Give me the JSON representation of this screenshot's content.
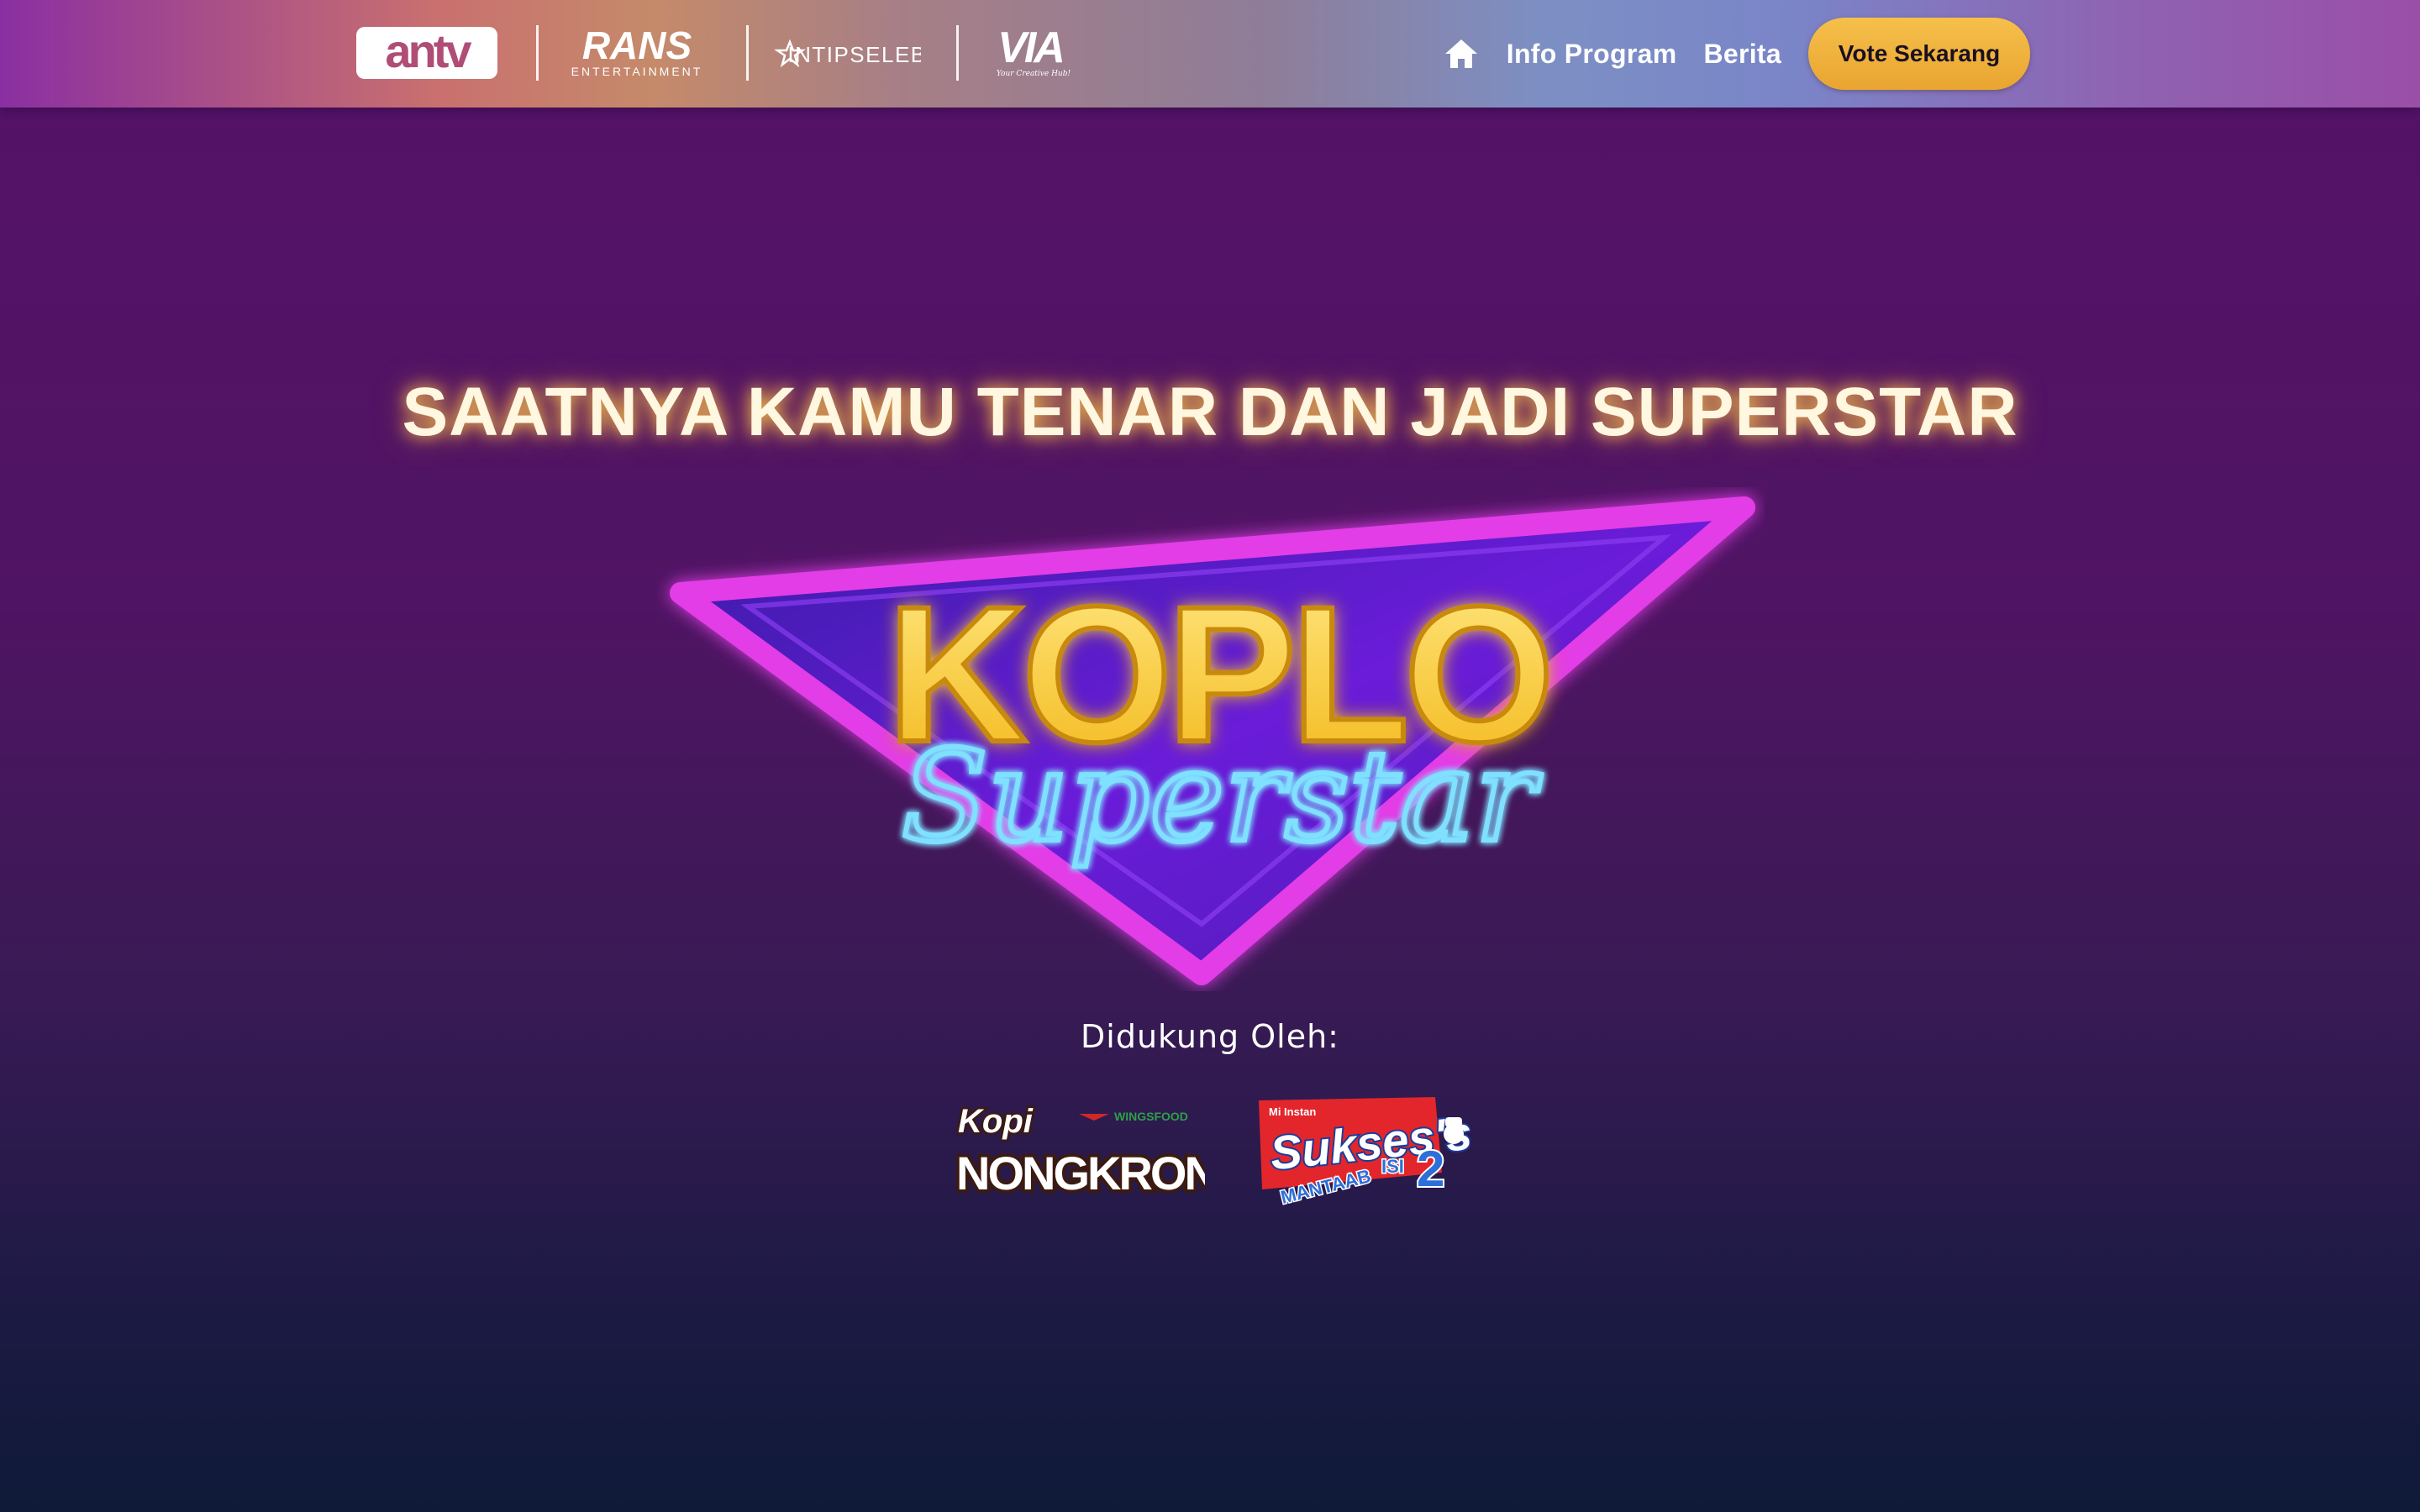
{
  "header": {
    "logos": {
      "antv": "antv",
      "rans": "RANS",
      "rans_sub": "ENTERTAINMENT",
      "intipseleb": "INTIPSELEB",
      "via": "VIA",
      "via_sub": "Your Creative Hub!"
    },
    "nav": {
      "home_icon": "home-icon",
      "links": [
        "Info Program",
        "Berita"
      ],
      "vote_label": "Vote Sekarang"
    }
  },
  "hero": {
    "tagline": "SAATNYA KAMU TENAR DAN JADI SUPERSTAR",
    "show_logo": {
      "title": "KOPLO",
      "subtitle": "Superstar"
    },
    "supported_by": "Didukung Oleh:",
    "sponsors": {
      "kopi": {
        "line1": "Kopi",
        "line2": "NONGKRONG",
        "brand": "WINGSFOOD"
      },
      "sukses": {
        "top": "Mi Instan",
        "name": "Sukses's",
        "sub": "MANTAAB",
        "isi": "ISI",
        "num": "2"
      }
    }
  },
  "colors": {
    "accent_button": "#f1b53d",
    "tagline_glow": "#ffc850",
    "logo_triangle": "#e23ee6",
    "logo_yellow": "#ffd23a",
    "logo_neon": "#6fd6ff"
  }
}
